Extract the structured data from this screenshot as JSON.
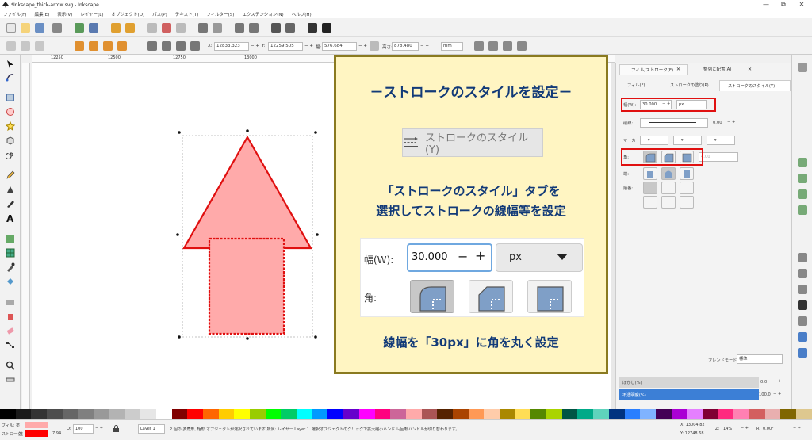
{
  "window": {
    "title": "*Inkscape_thick-arrow.svg - Inkscape",
    "controls": [
      "—",
      "⧉",
      "✕"
    ]
  },
  "menu": [
    "ファイル(F)",
    "編集(E)",
    "表示(V)",
    "レイヤー(L)",
    "オブジェクト(O)",
    "パス(P)",
    "テキスト(T)",
    "フィルター(S)",
    "エクステンション(N)",
    "ヘルプ(H)"
  ],
  "toolbar": {
    "x_label": "X:",
    "x_value": "12833.323",
    "y_label": "Y:",
    "y_value": "12259.505",
    "w_label": "幅:",
    "w_value": "576.684",
    "h_label": "高さ:",
    "h_value": "878.480",
    "unit": "mm"
  },
  "ruler": {
    "ticks": [
      "12250",
      "12500",
      "12750",
      "13000"
    ]
  },
  "callout": {
    "heading": "－ストロークのスタイルを設定－",
    "tab_label": "ストロークのスタイル(Y)",
    "desc_line1": "「ストロークのスタイル」タブを",
    "desc_line2": "選択してストロークの線幅等を設定",
    "width_label": "幅(W):",
    "width_value": "30.000",
    "unit": "px",
    "corner_label": "角:",
    "caption": "線幅を「30px」に角を丸く設定"
  },
  "dock": {
    "tabs": [
      "フィル/ストローク(F)",
      "整列と配置(A)"
    ],
    "subtabs": [
      "フィル(F)",
      "ストロークの塗り(P)",
      "ストロークのスタイル(Y)"
    ],
    "width_label": "幅(W):",
    "width_value": "30.000",
    "unit": "px",
    "dash_label": "破線:",
    "dash_value": "0.00",
    "marker_label": "マーカー:",
    "join_label": "角:",
    "cap_label": "端:",
    "order_label": "順番:",
    "blend_label": "ブレンドモード:",
    "blend_value": "標準",
    "blur_label": "ぼかし(%)",
    "blur_value": "0.0",
    "opacity_label": "不透明度(%)",
    "opacity_value": "100.0"
  },
  "status": {
    "fill_label": "フィル:",
    "fill_value": "塗",
    "stroke_label": "ストローク:",
    "stroke_value": "塗",
    "stroke_width": "7.94",
    "o_label": "O:",
    "o_value": "100",
    "layer": "Layer 1",
    "message": "2 個の 多角形, 矩形 オブジェクトが選択されています 所属: レイヤー Layer 1. 選択オブジェクトのクリックで拡大縮小ハンドル/回転ハンドルが切り替わります。",
    "cx": "X: 13004.82",
    "cy": "Y: 12748.68",
    "z_label": "Z:",
    "zoom": "14%",
    "r_label": "R:",
    "rotation": "0.00°"
  },
  "colors": {
    "accent": "#e01010",
    "callout_bg": "#fff5c2",
    "callout_border": "#8a7a20",
    "callout_text": "#123a78",
    "arrow_fill": "#ffaaaa",
    "arrow_stroke": "#e01010",
    "opacity_bar": "#3c7fd6"
  }
}
